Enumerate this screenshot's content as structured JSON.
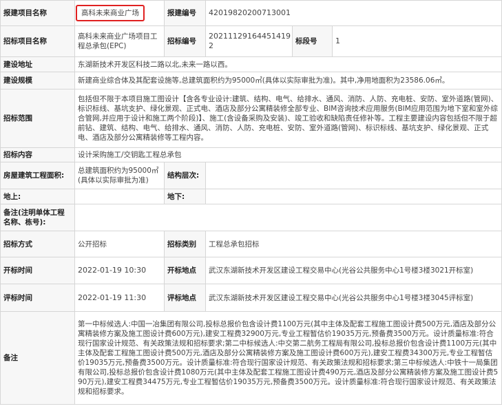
{
  "labels": {
    "project_name": "报建项目名称",
    "report_no": "报建编号",
    "tender_project": "招标项目名称",
    "tender_no": "招标编号",
    "section_no": "标段号",
    "address": "建设地址",
    "scale": "建设规模",
    "scope": "招标范围",
    "content": "招标内容",
    "area": "房屋建筑工程面积:",
    "structure": "结构层次:",
    "above": "地上:",
    "below": "地下:",
    "remark_unit": "备注(注明单体工程名称、栋号):",
    "method": "招标方式",
    "type": "招标类别",
    "open_time": "开标时间",
    "open_place": "开标地点",
    "eval_time": "评标时间",
    "eval_place": "评标地点",
    "remarks": "备注"
  },
  "values": {
    "project_name": "高科未来商业广场",
    "report_no": "42019820200713001",
    "tender_project": "高科未来商业广场项目工程总承包(EPC)",
    "tender_no": "20211129164451419​2",
    "section_no": "1",
    "address": "东湖新技术开发区科技二路以北,未来一路以西。",
    "scale": "新建商业综合体及其配套设施等,总建筑面积约为95000㎡(具体以实际审批为准)。其中,净用地面积为23586.06㎡。",
    "scope": "包括但不限于本项目施工图设计【含各专业设计:建筑、结构、电气、给排水、通风、消防、人防、充电桩、安防、室外道路(管网)、标识标线、基坑支护、绿化景观、正式电、酒店及部分公寓精装修全部专业、BIM咨询技术应用服务(BIM应用范围为地下室和室外综合管网,并应用于设计和施工两个阶段)】、施工(含设备采购及安装)、竣工验收和缺陷责任修补等。工程主要建设内容包括但不限于超前钻、建筑、结构、电气、给排水、通风、消防、人防、充电桩、安防、室外道路(管网)、标识标线、基坑支护、绿化景观、正式电、酒店及部分公寓精装修等工程内容。",
    "content": "设计采购施工/交钥匙工程总承包",
    "area": "总建筑面积约为95000㎡(具体以实际审批为准)",
    "structure": "",
    "above": "",
    "below": "",
    "remark_unit": "",
    "method": "公开招标",
    "type": "工程总承包招标",
    "open_time": "2022-01-19 10:30",
    "open_place": "武汉东湖新技术开发区建设工程交易中心(光谷公共服务中心1号楼3楼3021开标室)",
    "eval_time": "2022-01-19 11:30",
    "eval_place": "武汉东湖新技术开发区建设工程交易中心(光谷公共服务中心1号楼3楼3045评标室)",
    "remarks": "第一中标候选人:中国一冶集团有限公司,投标总报价包含设计费1100万元(其中主体及配套工程施工图设计费500万元,酒店及部分公寓精装修方案及施工图设计费600万元),建安工程费32900万元,专业工程暂估价19035万元,预备费3500万元。设计质量标准:符合现行国家设计规范、有关政策法规和招标要求;第二中标候选人:中交第二航务工程局有限公司,投标总报价包含设计费1100万元(其中主体及配套工程施工图设计费500万元,酒店及部分公寓精装修方案及施工图设计费600万元),建安工程费34300万元,专业工程暂估价19035万元,预备费3500万元。设计质量标准:符合现行国家设计规范、有关政策法规和招标要求;第三中标候选人:中铁十一局集团有限公司,投标总报价包含设计费1080万元(其中主体及配套工程施工图设计费490万元,酒店及部分公寓精装修方案及施工图设计费590万元),建安工程费34475万元,专业工程暂估价19035万元,预备费3500万元。设计质量标准:符合现行国家设计规范、有关政策法规和招标要求。"
  }
}
